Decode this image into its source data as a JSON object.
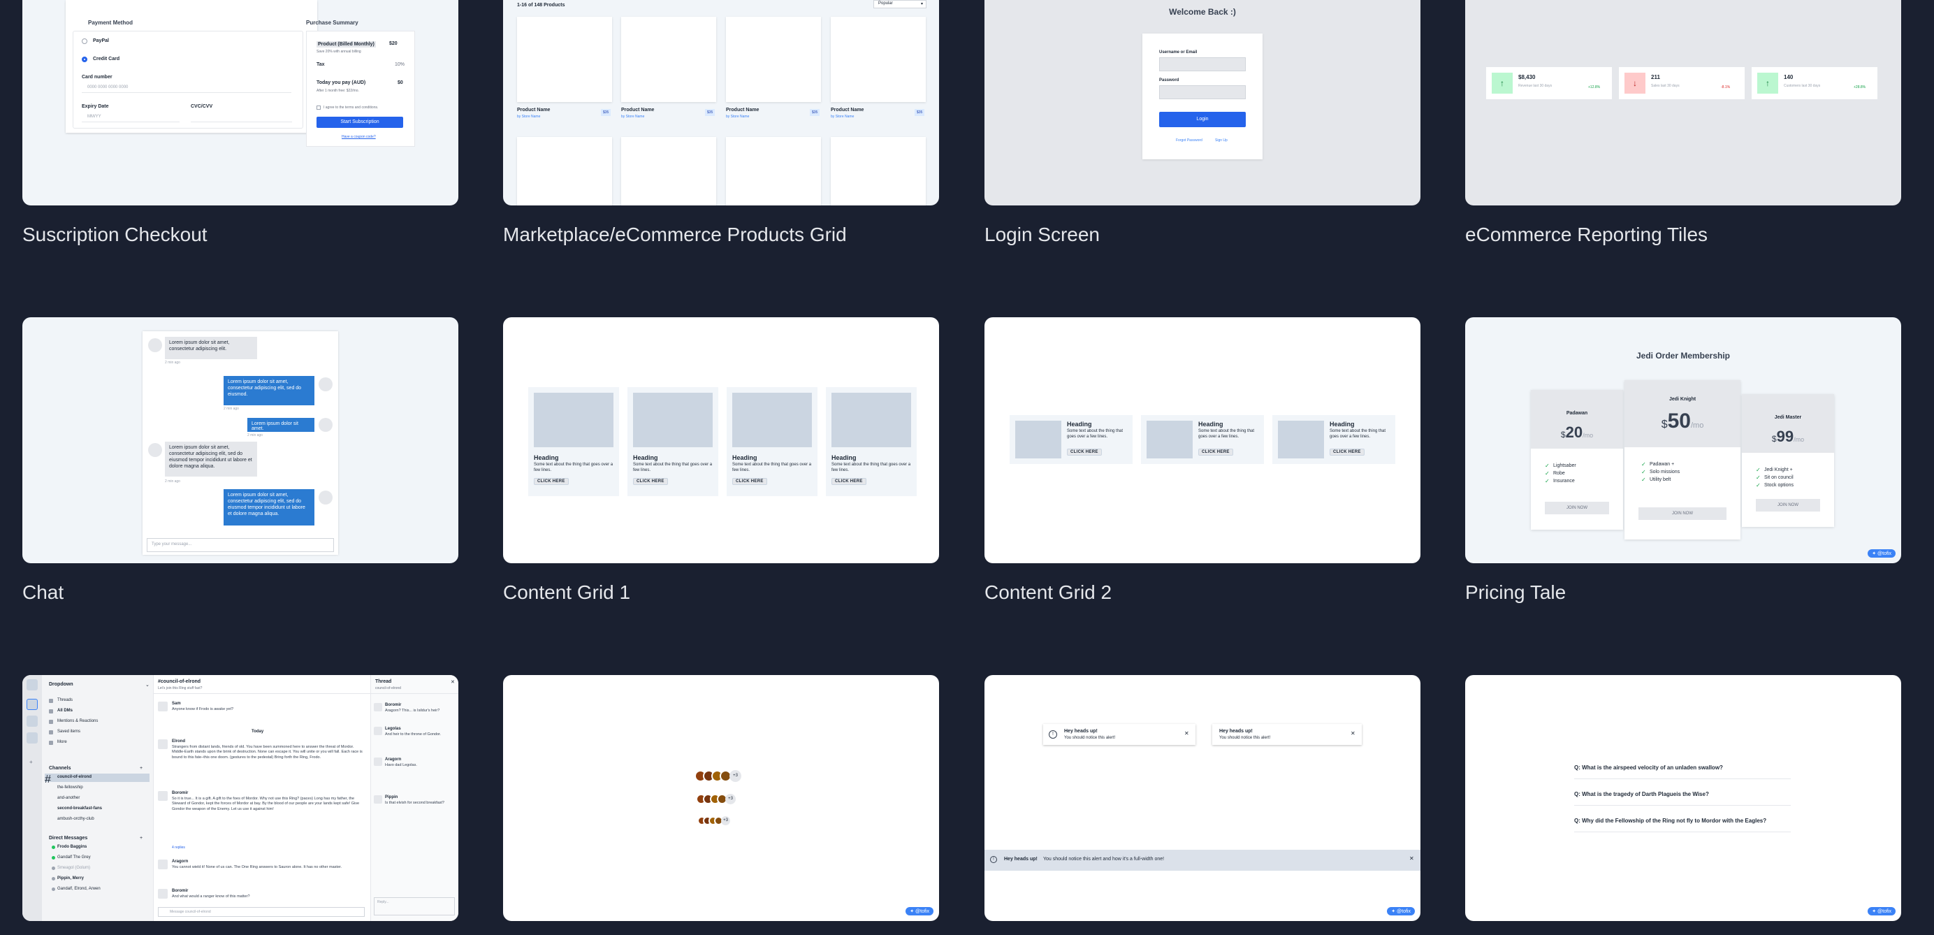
{
  "cards": {
    "checkout": {
      "caption": "Suscription Checkout",
      "payment_title": "Payment Method",
      "paypal": "PayPal",
      "credit_card": "Credit Card",
      "card_number_label": "Card number",
      "card_number_placeholder": "0000 0000 0000 0000",
      "expiry_label": "Expiry Date",
      "expiry_placeholder": "MM/YY",
      "cvc_label": "CVC/CVV",
      "summary_title": "Purchase Summary",
      "product": "Product (Billed Monthly)",
      "product_price": "$20",
      "product_sub": "Save 20% with annual billing",
      "tax_label": "Tax",
      "tax_value": "10%",
      "today_label": "Today you pay (AUD)",
      "today_value": "$0",
      "today_sub": "After 1 month free: $22/mo.",
      "terms": "I agree to the terms and conditions.",
      "start_button": "Start Subscription",
      "coupon_link": "Have a coupon code?"
    },
    "products": {
      "caption": "Marketplace/eCommerce Products Grid",
      "count": "1-16 of 148 Products",
      "sort": "Popular",
      "product_name": "Product Name",
      "store": "by Store Name",
      "price": "$35"
    },
    "login": {
      "caption": "Login Screen",
      "title": "Welcome Back :)",
      "user_label": "Username or Email",
      "password_label": "Password",
      "login_button": "Login",
      "forgot": "Forgot Password",
      "signup": "Sign Up"
    },
    "reporting": {
      "caption": "eCommerce Reporting Tiles",
      "tiles": [
        {
          "value": "$8,430",
          "label": "Revenue last 30 days",
          "delta": "+12.8%"
        },
        {
          "value": "211",
          "label": "Sales last 30 days",
          "delta": "-8.1%"
        },
        {
          "value": "140",
          "label": "Customers last 30 days",
          "delta": "+28.8%"
        }
      ]
    },
    "chat": {
      "caption": "Chat",
      "msg_short": "Lorem ipsum dolor sit amet, consectetur adipiscing elit.",
      "msg_med": "Lorem ipsum dolor sit amet, consectetur adipiscing elit, sed do eiusmod.",
      "msg_tiny": "Lorem ipsum dolor sit amet.",
      "msg_long": "Lorem ipsum dolor sit amet, consectetur adipiscing elit, sed do eiusmod tempor incididunt ut labore et dolore magna aliqua.",
      "time": "2 min ago",
      "input_placeholder": "Type your message..."
    },
    "grid1": {
      "caption": "Content Grid 1",
      "heading": "Heading",
      "text": "Some text about the thing that goes over a few lines.",
      "button": "CLICK HERE"
    },
    "grid2": {
      "caption": "Content Grid 2",
      "heading": "Heading",
      "text": "Some text about the thing that goes over a few lines.",
      "button": "CLICK HERE"
    },
    "pricing": {
      "caption": "Pricing Tale",
      "title": "Jedi Order Membership",
      "plans": [
        {
          "name": "Padawan",
          "price": "20",
          "features": [
            "Lightsaber",
            "Robe",
            "Insurance"
          ],
          "button": "JOIN NOW"
        },
        {
          "name": "Jedi Knight",
          "price": "50",
          "features": [
            "Padawan +",
            "Solo missions",
            "Utility belt"
          ],
          "button": "JOIN NOW"
        },
        {
          "name": "Jedi Master",
          "price": "99",
          "features": [
            "Jedi Knight +",
            "Sit on council",
            "Stock options"
          ],
          "button": "JOIN NOW"
        }
      ],
      "currency": "$",
      "period": "/mo",
      "badge": "@tofix"
    },
    "slack": {
      "workspace": "Dropdown",
      "nav": [
        "Threads",
        "All DMs",
        "Mentions & Reactions",
        "Saved items",
        "More"
      ],
      "channels_title": "Channels",
      "channels": [
        "council-of-elrond",
        "the-fellowship",
        "and-another",
        "second-breakfast-fans",
        "ambush-orcthy-club"
      ],
      "dms_title": "Direct Messages",
      "dms": [
        "Frodo Baggins",
        "Gandalf The Grey",
        "Smeagol (Golum)",
        "Pippin, Merry",
        "Gandalf, Elrond, Arwen"
      ],
      "channel_name": "#council-of-elrond",
      "channel_topic": "Let's join this Ring stuff fast?",
      "today": "Today",
      "messages": [
        {
          "author": "Sam",
          "text": "Anyone know if Frodo is awake yet?"
        },
        {
          "author": "Elrond",
          "text": "Strangers from distant lands, friends of old. You have been summoned here to answer the threat of Mordor. Middle-Earth stands upon the brink of destruction. None can escape it. You will unite or you will fall. Each race is bound to this fate–this one doom. (gestures to the pedestal) Bring forth the Ring, Frodo."
        },
        {
          "author": "Boromir",
          "text": "So it is true... It is a gift. A gift to the foes of Mordor. Why not use this Ring? (paces) Long has my father, the Steward of Gondor, kept the forces of Mordor at bay. By the blood of our people are your lands kept safe! Give Gondor the weapon of the Enemy. Let us use it against him!"
        },
        {
          "author": "Aragorn",
          "text": "You cannot wield it! None of us can. The One Ring answers to Sauron alone. It has no other master."
        },
        {
          "author": "Boromir",
          "text": "And what would a ranger know of this matter?"
        }
      ],
      "reply_count": "4 replies",
      "message_placeholder": "Message council-of-elrond",
      "thread_title": "Thread",
      "thread_sub": "council-of-elrond",
      "thread": [
        {
          "author": "Boromir",
          "text": "Aragorn? This... is Isildur's heir?"
        },
        {
          "author": "Legolas",
          "text": "And heir to the throne of Gondor."
        },
        {
          "author": "Aragorn",
          "text": "Havo dad Legolas."
        },
        {
          "author": "Pippin",
          "text": "Is that elvish for second breakfast?"
        }
      ],
      "reply_placeholder": "Reply..."
    },
    "avatars": {
      "counts": [
        "+3",
        "+3",
        "+3"
      ],
      "badge": "@tofix"
    },
    "alerts": {
      "title": "Hey heads up!",
      "text": "You should notice this alert!",
      "full_text": "You should notice this alert and how it's a full-width one!",
      "badge": "@tofix"
    },
    "faq": {
      "questions": [
        "Q: What is the airspeed velocity of an unladen swallow?",
        "Q: What is the tragedy of Darth Plagueis the Wise?",
        "Q: Why did the Fellowship of the Ring not fly to Mordor with the Eagles?"
      ],
      "badge": "@tofix"
    }
  }
}
